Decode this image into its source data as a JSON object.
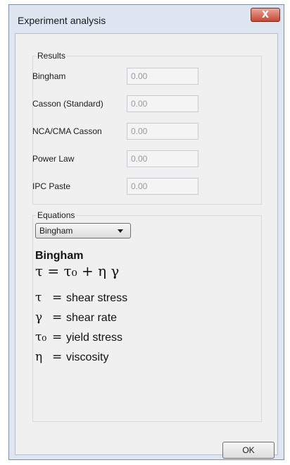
{
  "window": {
    "title": "Experiment analysis",
    "close_glyph": "X"
  },
  "results": {
    "legend": "Results",
    "rows": [
      {
        "label": "Bingham",
        "value": "0.00"
      },
      {
        "label": "Casson (Standard)",
        "value": "0.00"
      },
      {
        "label": "NCA/CMA Casson",
        "value": "0.00"
      },
      {
        "label": "Power Law",
        "value": "0.00"
      },
      {
        "label": "IPC Paste",
        "value": "0.00"
      }
    ]
  },
  "equations": {
    "legend": "Equations",
    "selected_model": "Bingham",
    "model_title": "Bingham",
    "formula": "τ = τ₀ + η γ",
    "definitions": [
      {
        "symbol": "τ",
        "sep": "=",
        "meaning": "shear stress"
      },
      {
        "symbol": "γ",
        "sep": "=",
        "meaning": "shear rate"
      },
      {
        "symbol": "τ₀",
        "sep": "=",
        "meaning": "yield stress"
      },
      {
        "symbol": "η",
        "sep": "=",
        "meaning": "viscosity"
      }
    ]
  },
  "buttons": {
    "ok_label": "OK"
  }
}
